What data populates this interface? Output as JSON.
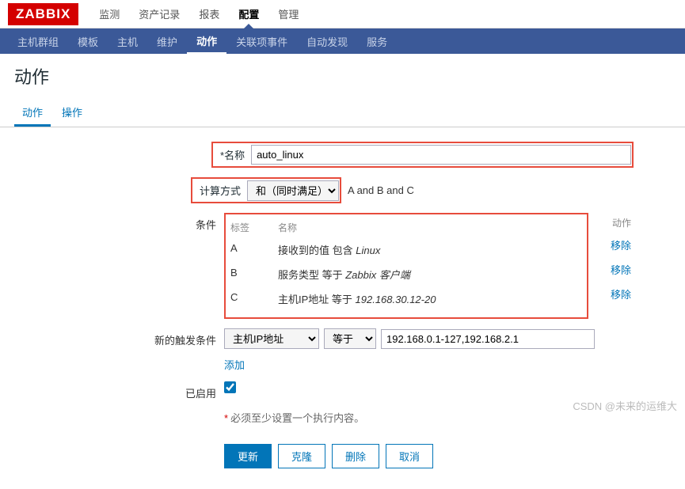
{
  "logo": "ZABBIX",
  "topnav": [
    "监测",
    "资产记录",
    "报表",
    "配置",
    "管理"
  ],
  "topnav_active": 3,
  "subnav": [
    "主机群组",
    "模板",
    "主机",
    "维护",
    "动作",
    "关联项事件",
    "自动发现",
    "服务"
  ],
  "subnav_active": 4,
  "page_title": "动作",
  "tabs": [
    "动作",
    "操作"
  ],
  "tabs_active": 0,
  "labels": {
    "name": "名称",
    "calc": "计算方式",
    "cond": "条件",
    "new_trigger": "新的触发条件",
    "enabled": "已启用"
  },
  "name_value": "auto_linux",
  "calc_option": "和（同时满足）",
  "calc_result": "A and B and C",
  "cond_headers": {
    "tag": "标签",
    "name": "名称",
    "action": "动作"
  },
  "conditions": [
    {
      "tag": "A",
      "text_pre": "接收到的值 包含 ",
      "text_em": "Linux"
    },
    {
      "tag": "B",
      "text_pre": "服务类型 等于 ",
      "text_em": "Zabbix 客户端"
    },
    {
      "tag": "C",
      "text_pre": "主机IP地址 等于 ",
      "text_em": "192.168.30.12-20"
    }
  ],
  "remove_label": "移除",
  "trigger": {
    "type": "主机IP地址",
    "op": "等于",
    "value": "192.168.0.1-127,192.168.2.1"
  },
  "add_label": "添加",
  "enabled": true,
  "note": "必须至少设置一个执行内容。",
  "buttons": {
    "update": "更新",
    "clone": "克隆",
    "delete": "删除",
    "cancel": "取消"
  },
  "watermark": "CSDN @未来的运维大"
}
